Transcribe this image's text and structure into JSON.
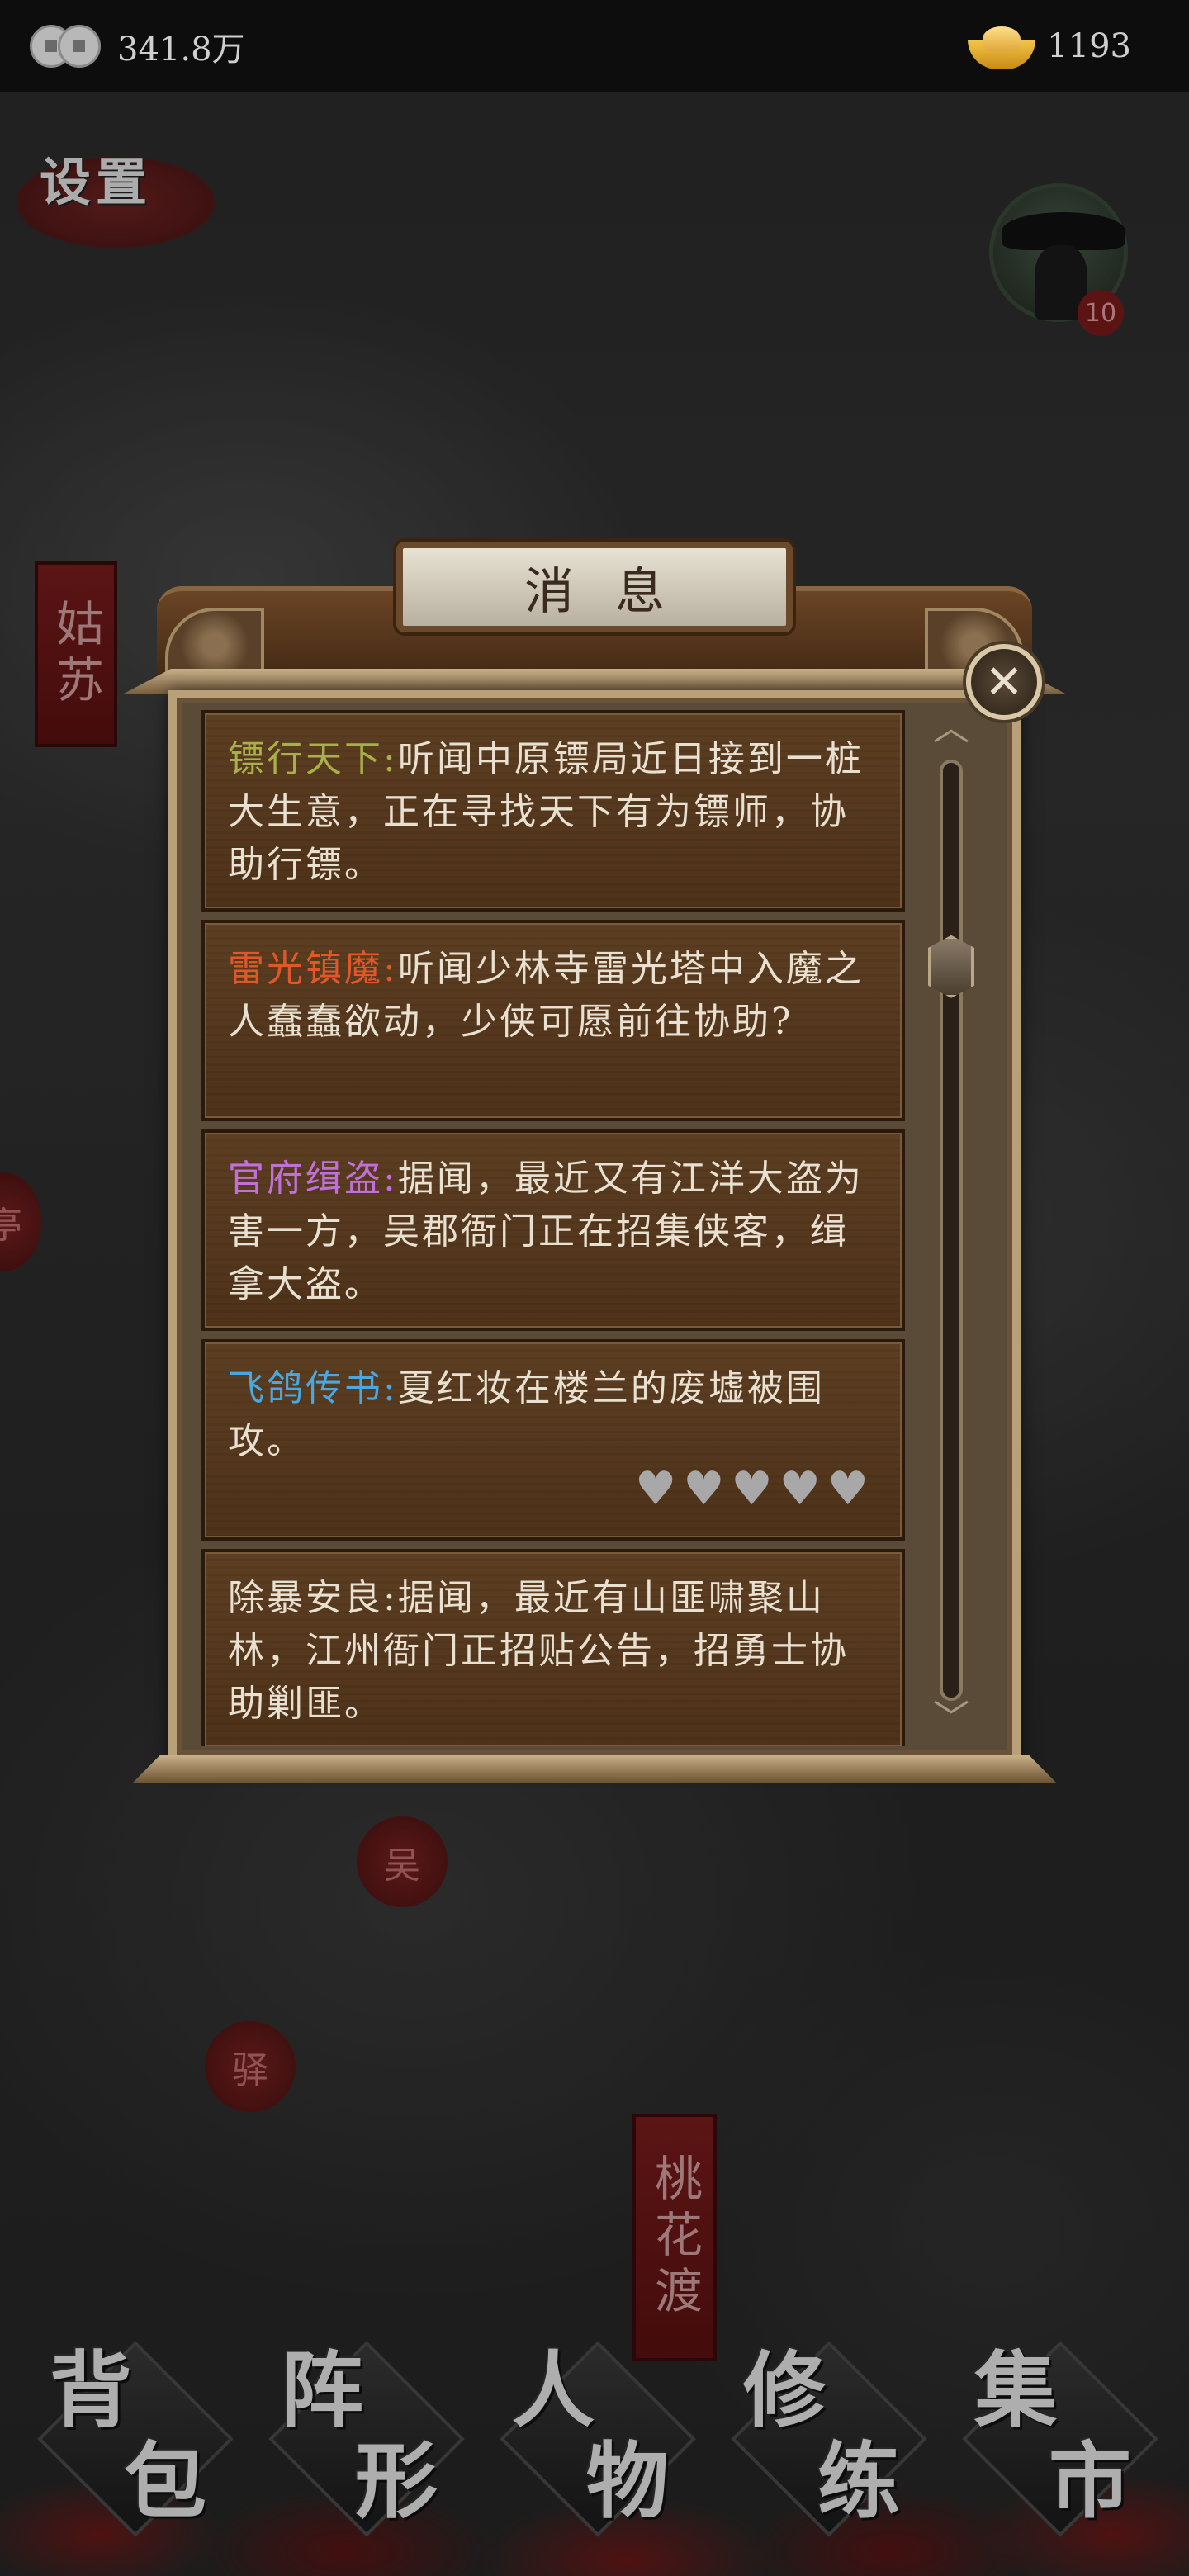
{
  "topbar": {
    "coins": "341.8万",
    "coin_icon": "copper-coins-icon",
    "gold": "1193",
    "gold_icon": "gold-ingot-icon"
  },
  "settings_label": "设置",
  "avatar": {
    "level": "10"
  },
  "map_locations": {
    "gusu": "姑苏",
    "wu": "吴",
    "yi": "驿",
    "taohuadu": "桃花渡",
    "edge": "亭"
  },
  "dialog": {
    "title": "消息",
    "close_icon": "close-icon",
    "messages": [
      {
        "tag": "镖行天下:",
        "tag_color": "#a8b04a",
        "text": "听闻中原镖局近日接到一桩大生意，正在寻找天下有为镖师，协助行镖。"
      },
      {
        "tag": "雷光镇魔:",
        "tag_color": "#e0582a",
        "text": "听闻少林寺雷光塔中入魔之人蠢蠢欲动，少侠可愿前往协助?"
      },
      {
        "tag": "官府缉盗:",
        "tag_color": "#c070d8",
        "text": "据闻，最近又有江洋大盗为害一方，吴郡衙门正在招集侠客，缉拿大盗。"
      },
      {
        "tag": "飞鸽传书:",
        "tag_color": "#4aa8e0",
        "text": "夏红妆在楼兰的废墟被围攻。",
        "hearts": 5,
        "hearts_filled": 0
      },
      {
        "tag": "",
        "tag_color": "#e8e0d0",
        "text": "除暴安良:据闻，最近有山匪啸聚山林，江州衙门正招贴公告，招勇士协助剿匪。"
      }
    ],
    "scroll": {
      "position": 0.2
    }
  },
  "bottom_menu": [
    {
      "c1": "背",
      "c2": "包"
    },
    {
      "c1": "阵",
      "c2": "形"
    },
    {
      "c1": "人",
      "c2": "物"
    },
    {
      "c1": "修",
      "c2": "练"
    },
    {
      "c1": "集",
      "c2": "市"
    }
  ]
}
